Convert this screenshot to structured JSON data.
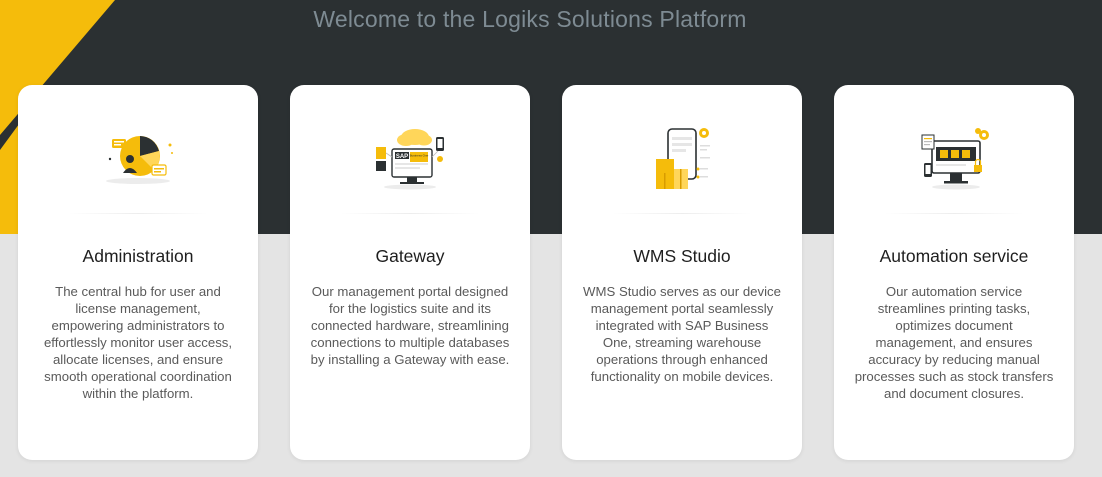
{
  "page": {
    "title": "Welcome to the Logiks Solutions Platform"
  },
  "colors": {
    "hero_bg": "#2b3032",
    "accent_yellow": "#f5bc0b",
    "page_bg": "#e4e4e4",
    "card_bg": "#ffffff",
    "title_color": "#7e8b93"
  },
  "cards": [
    {
      "title": "Administration",
      "description": "The central hub for user and license management, empowering administrators to effortlessly monitor user access, allocate licenses, and ensure smooth operational coordination within the platform.",
      "icon": "admin-dashboard-icon"
    },
    {
      "title": "Gateway",
      "description": "Our management portal designed for the logistics suite and its connected hardware, streamlining connections to multiple databases by installing a Gateway with ease.",
      "icon": "gateway-sap-icon",
      "illustration_text": [
        "SAP",
        "Business One"
      ]
    },
    {
      "title": "WMS Studio",
      "description": "WMS Studio serves as our device management portal seamlessly integrated with SAP Business One, streaming warehouse operations through enhanced functionality on mobile devices.",
      "icon": "wms-mobile-warehouse-icon"
    },
    {
      "title": "Automation service",
      "description": "Our automation service streamlines printing tasks, optimizes document management, and ensures accuracy by reducing manual processes such as stock transfers and document closures.",
      "icon": "automation-monitor-icon"
    }
  ]
}
